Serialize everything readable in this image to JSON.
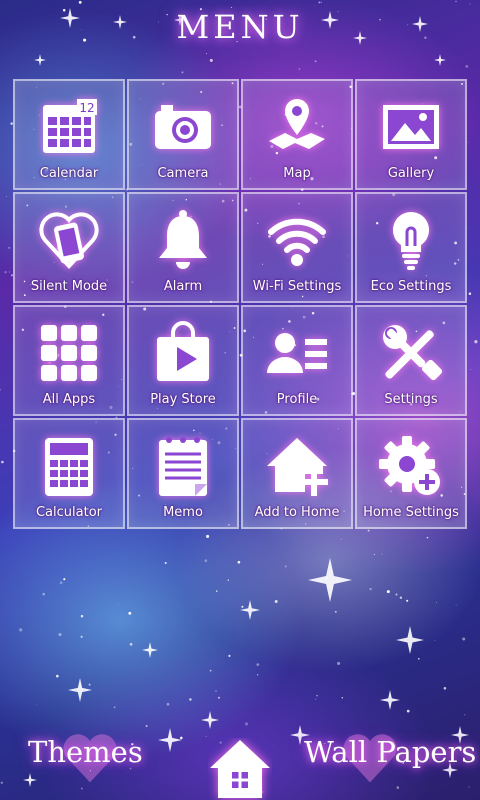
{
  "header": {
    "title": "MENU"
  },
  "menu": [
    {
      "label": "Calendar",
      "icon": "calendar-icon",
      "badge": "12"
    },
    {
      "label": "Camera",
      "icon": "camera-icon"
    },
    {
      "label": "Map",
      "icon": "map-icon"
    },
    {
      "label": "Gallery",
      "icon": "gallery-icon"
    },
    {
      "label": "Silent Mode",
      "icon": "silent-mode-icon"
    },
    {
      "label": "Alarm",
      "icon": "alarm-bell-icon"
    },
    {
      "label": "Wi-Fi Settings",
      "icon": "wifi-icon"
    },
    {
      "label": "Eco Settings",
      "icon": "lightbulb-icon"
    },
    {
      "label": "All Apps",
      "icon": "grid-icon"
    },
    {
      "label": "Play Store",
      "icon": "play-store-icon"
    },
    {
      "label": "Profile",
      "icon": "profile-icon"
    },
    {
      "label": "Settings",
      "icon": "tools-icon"
    },
    {
      "label": "Calculator",
      "icon": "calculator-icon"
    },
    {
      "label": "Memo",
      "icon": "memo-icon"
    },
    {
      "label": "Add to Home",
      "icon": "add-home-icon"
    },
    {
      "label": "Home Settings",
      "icon": "gear-plus-icon"
    }
  ],
  "footer": {
    "themes_label": "Themes",
    "wallpapers_label": "Wall Papers",
    "home_icon": "home-icon"
  },
  "colors": {
    "glow_pink": "#ff7df5",
    "glow_purple": "#c24bff",
    "tile_border": "#ffffff"
  }
}
